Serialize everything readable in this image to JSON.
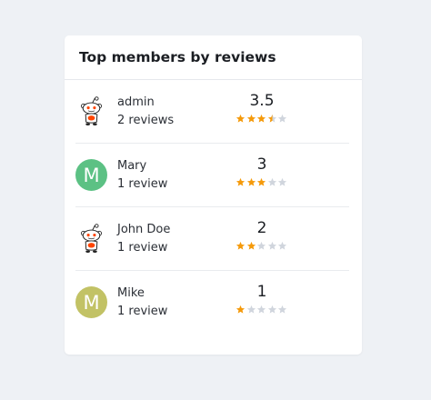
{
  "card": {
    "title": "Top members by reviews"
  },
  "colors": {
    "star_filled": "#f59a0b",
    "star_empty": "#d0d5dd",
    "avatar_mary": "#5cc184",
    "avatar_mike": "#c2c265",
    "reddit_accent": "#ff4500"
  },
  "members": [
    {
      "name": "admin",
      "reviews": "2 reviews",
      "rating_text": "3.5",
      "rating": 3.5,
      "avatar": {
        "type": "image",
        "icon": "reddit-alien-avatar-icon"
      }
    },
    {
      "name": "Mary",
      "reviews": "1 review",
      "rating_text": "3",
      "rating": 3,
      "avatar": {
        "type": "initial",
        "initial": "M",
        "color": "#5cc184"
      }
    },
    {
      "name": "John Doe",
      "reviews": "1 review",
      "rating_text": "2",
      "rating": 2,
      "avatar": {
        "type": "image",
        "icon": "reddit-alien-avatar-icon"
      }
    },
    {
      "name": "Mike",
      "reviews": "1 review",
      "rating_text": "1",
      "rating": 1,
      "avatar": {
        "type": "initial",
        "initial": "M",
        "color": "#c2c265"
      }
    }
  ]
}
